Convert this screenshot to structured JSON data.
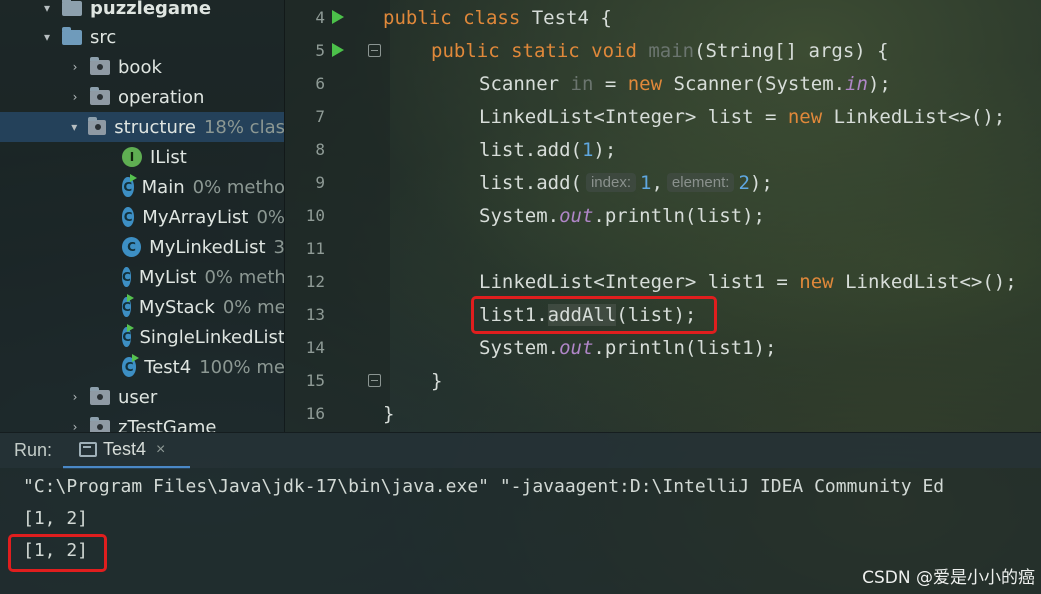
{
  "project_tree": [
    {
      "label": "puzzlegame",
      "coverage": "",
      "kind": "module"
    },
    {
      "label": "src",
      "coverage": "",
      "kind": "src"
    },
    {
      "label": "book",
      "coverage": "",
      "kind": "package"
    },
    {
      "label": "operation",
      "coverage": "",
      "kind": "package"
    },
    {
      "label": "structure",
      "coverage": "18% clas",
      "kind": "package"
    },
    {
      "label": "IList",
      "coverage": "",
      "kind": "interface"
    },
    {
      "label": "Main",
      "coverage": "0% metho",
      "kind": "class"
    },
    {
      "label": "MyArrayList",
      "coverage": "0%",
      "kind": "class"
    },
    {
      "label": "MyLinkedList",
      "coverage": "3",
      "kind": "class"
    },
    {
      "label": "MyList",
      "coverage": "0% meth",
      "kind": "class"
    },
    {
      "label": "MyStack",
      "coverage": "0% me",
      "kind": "class"
    },
    {
      "label": "SingleLinkedList",
      "coverage": "",
      "kind": "class"
    },
    {
      "label": "Test4",
      "coverage": "100% me",
      "kind": "class"
    },
    {
      "label": "user",
      "coverage": "",
      "kind": "package"
    },
    {
      "label": "zTestGame",
      "coverage": "",
      "kind": "package"
    }
  ],
  "interface_badge": "I",
  "class_badge": "C",
  "editor": {
    "line_numbers": [
      "4",
      "5",
      "6",
      "7",
      "8",
      "9",
      "10",
      "11",
      "12",
      "13",
      "14",
      "15",
      "16"
    ],
    "tokens": {
      "l4_kw": "public class",
      "l4_rest": " Test4 {",
      "l5_kw": "public static void",
      "l5_main": " main",
      "l5_rest": "(String[] args) {",
      "l6_a": "Scanner ",
      "l6_in": "in",
      "l6_b": " = ",
      "l6_new": "new",
      "l6_c": " Scanner(System.",
      "l6_in2": "in",
      "l6_d": ");",
      "l7_a": "LinkedList<Integer> list = ",
      "l7_new": "new",
      "l7_b": " LinkedList<>();",
      "l8_a": "list.add(",
      "l8_num": "1",
      "l8_b": ");",
      "l9_a": "list.add(",
      "l9_hint1": "index:",
      "l9_num1": "1",
      "l9_sep": ",",
      "l9_hint2": "element:",
      "l9_num2": "2",
      "l9_b": ");",
      "l10_a": "System.",
      "l10_out": "out",
      "l10_b": ".println(list);",
      "l12_a": "LinkedList<Integer> list1 = ",
      "l12_new": "new",
      "l12_b": " LinkedList<>();",
      "l13_a": "list1.",
      "l13_hl": "addAll",
      "l13_b": "(list);",
      "l14_a": "System.",
      "l14_out": "out",
      "l14_b": ".println(list1);",
      "l15": "}",
      "l16": "}"
    }
  },
  "run_panel": {
    "label": "Run:",
    "tab_label": "Test4",
    "close_glyph": "×"
  },
  "console": {
    "lines": [
      "\"C:\\Program Files\\Java\\jdk-17\\bin\\java.exe\" \"-javaagent:D:\\IntelliJ IDEA Community Ed",
      "[1, 2]",
      "[1, 2]"
    ]
  },
  "watermark": "CSDN @爱是小小的癌",
  "colors": {
    "keyword": "#e0883a",
    "number": "#5fa7e0",
    "static_field": "#b086c8",
    "highlight_box": "#e01e1e",
    "selection": "#264664"
  }
}
